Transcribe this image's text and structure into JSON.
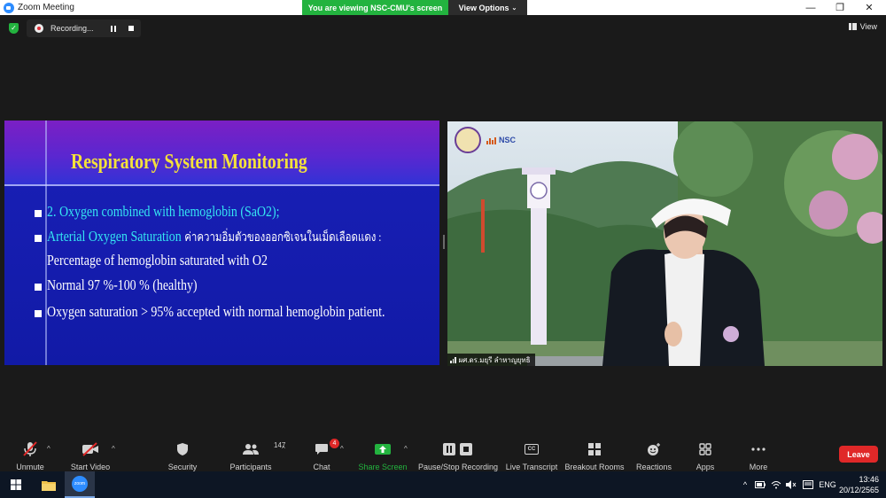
{
  "window": {
    "title": "Zoom Meeting",
    "viewing_banner": "You are viewing NSC-CMU's screen",
    "view_options": "View Options",
    "minimize": "—",
    "restore": "❐",
    "close": "✕"
  },
  "topbar": {
    "recording_label": "Recording...",
    "view_label": "View"
  },
  "slide": {
    "title": "Respiratory System Monitoring",
    "line1": "2. Oxygen combined with hemoglobin (SaO2);",
    "line2_cyan": "Arterial Oxygen Saturation",
    "line2_thai": "ค่าความอิ่มตัวของออกซิเจนในเม็ดเลือดแดง :",
    "line3": "Percentage of hemoglobin saturated with O2",
    "line4": "Normal 97 %-100 % (healthy)",
    "line5": "Oxygen saturation > 95% accepted with normal hemoglobin patient."
  },
  "video": {
    "participant_name": "ผศ.ดร.มยุรี ลำหาญยุทธิ",
    "logo_text": "NSC"
  },
  "toolbar": {
    "unmute": "Unmute",
    "start_video": "Start Video",
    "security": "Security",
    "participants": "Participants",
    "participants_count": "147",
    "chat": "Chat",
    "chat_badge": "4",
    "share_screen": "Share Screen",
    "pause_stop_recording": "Pause/Stop Recording",
    "live_transcript": "Live Transcript",
    "cc_text": "CC",
    "breakout_rooms": "Breakout Rooms",
    "reactions": "Reactions",
    "apps": "Apps",
    "more": "More",
    "leave": "Leave"
  },
  "taskbar": {
    "zoom_icon_text": "zoom",
    "lang": "ENG",
    "time": "13:46",
    "date": "20/12/2565"
  },
  "colors": {
    "share_green": "#23b33f",
    "leave_red": "#e02828",
    "slide_title_yellow": "#f4e23a",
    "slide_cyan": "#35e6f2"
  }
}
